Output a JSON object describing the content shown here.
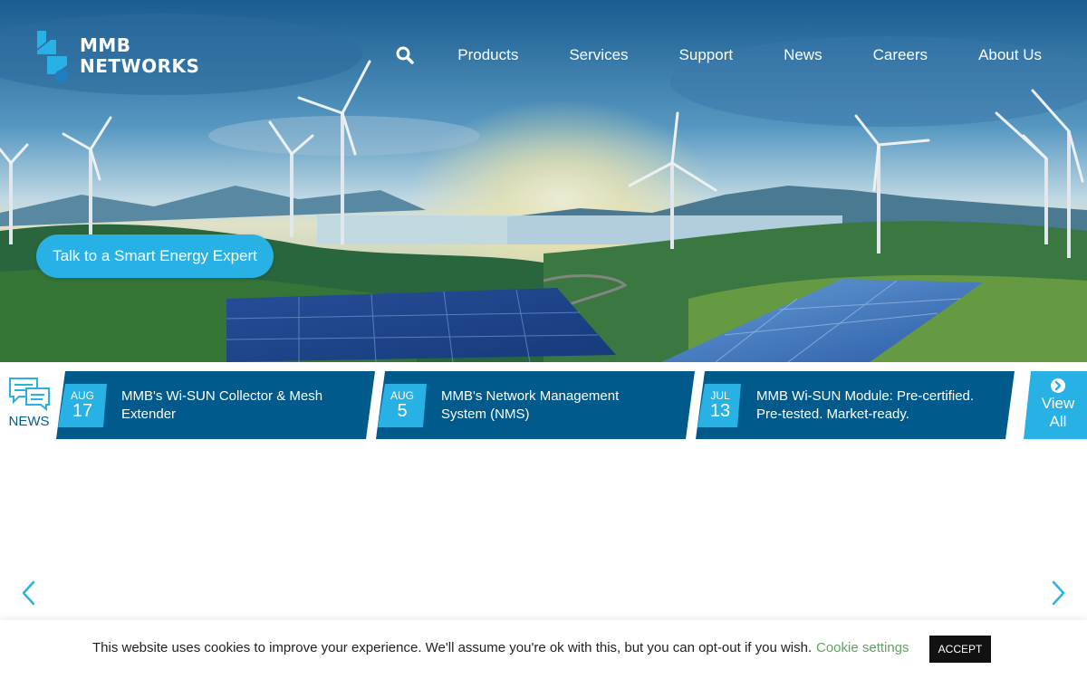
{
  "brand": {
    "line1": "MMB",
    "line2": "NETWORKS"
  },
  "nav": {
    "search_icon": "search-icon",
    "items": [
      "Products",
      "Services",
      "Support",
      "News",
      "Careers",
      "About Us"
    ]
  },
  "hero": {
    "cta_label": "Talk to a Smart Energy Expert"
  },
  "news": {
    "label": "NEWS",
    "items": [
      {
        "month": "AUG",
        "day": "17",
        "title": "MMB's Wi-SUN Collector & Mesh Extender"
      },
      {
        "month": "AUG",
        "day": "5",
        "title": "MMB's Network Management System (NMS)"
      },
      {
        "month": "JUL",
        "day": "13",
        "title": "MMB Wi-SUN Module: Pre-certified. Pre-tested. Market-ready."
      }
    ],
    "view_all_line1": "View",
    "view_all_line2": "All"
  },
  "cookie": {
    "message": "This website uses cookies to improve your experience. We'll assume you're ok with this, but you can opt-out if you wish.",
    "settings_label": "Cookie settings",
    "accept_label": "ACCEPT"
  },
  "colors": {
    "accent": "#27b1e4",
    "navy": "#0a5a8e",
    "cookie_link": "#5fa35f"
  }
}
